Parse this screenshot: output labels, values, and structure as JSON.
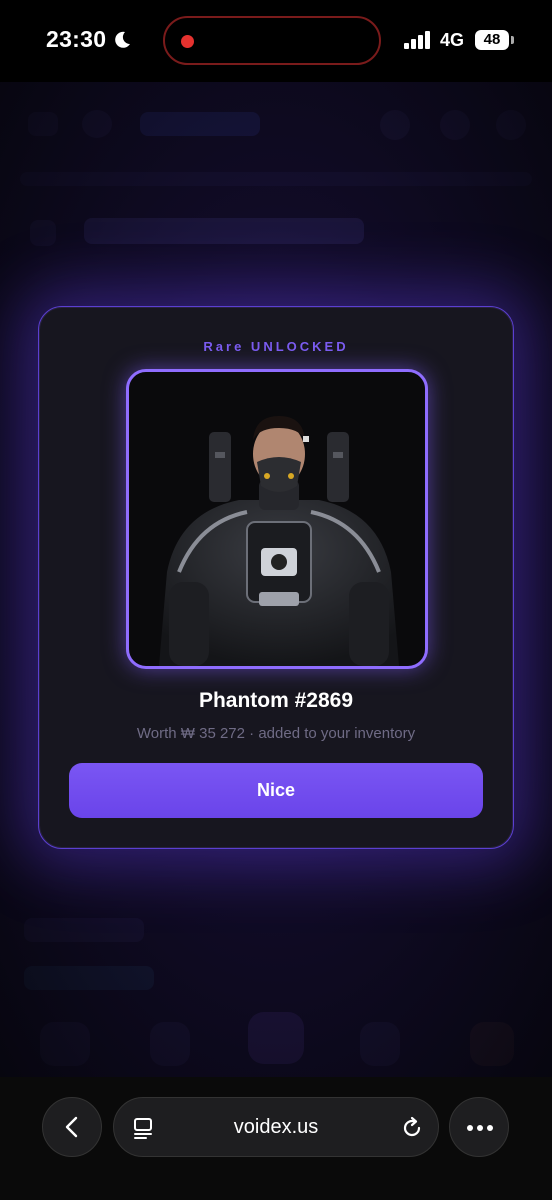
{
  "status_bar": {
    "time": "23:30",
    "network": "4G",
    "battery": "48",
    "icons": [
      "moon-icon",
      "signal-icon",
      "battery-icon"
    ]
  },
  "modal": {
    "rarity_label": "Rare UNLOCKED",
    "item_name": "Phantom #2869",
    "subtitle": "Worth ₩  35  272 · added to your inventory",
    "button_label": "Nice",
    "accent_color": "#7b5cf0"
  },
  "browser": {
    "url": "voidex.us",
    "icons": [
      "back-icon",
      "tabs-icon",
      "reload-icon",
      "more-icon"
    ]
  }
}
